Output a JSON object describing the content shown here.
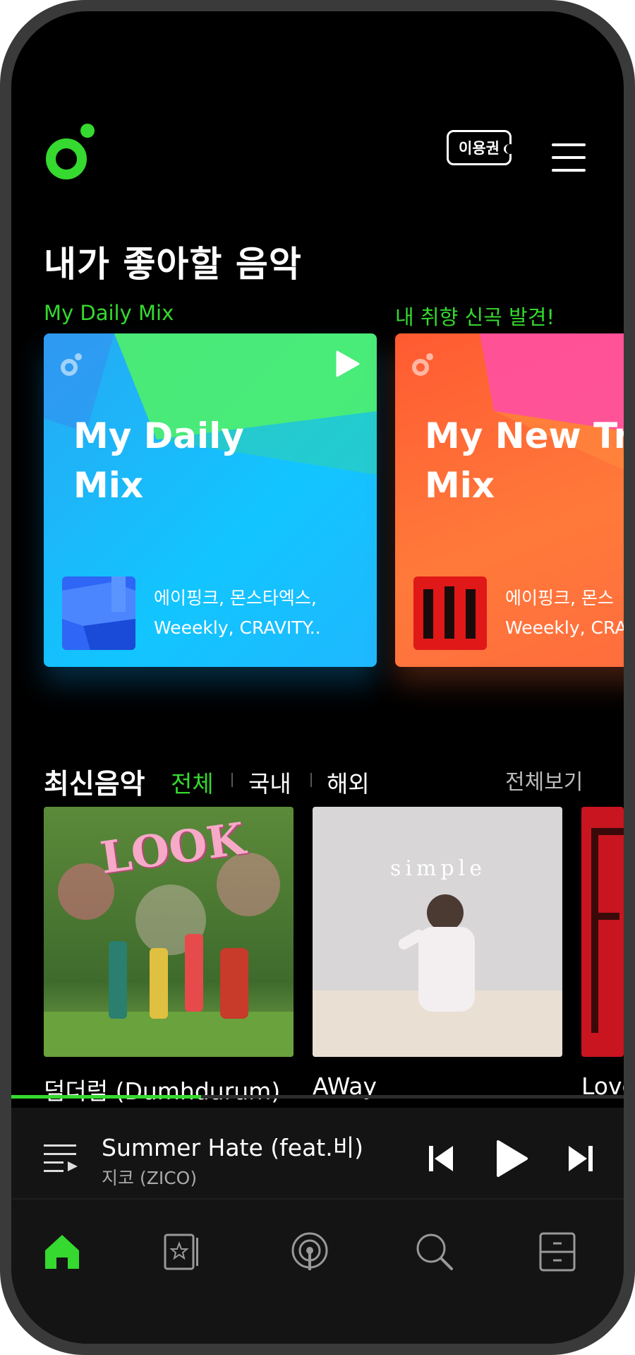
{
  "header": {
    "logo": "melon-logo",
    "ticket_label": "이용권",
    "menu_icon": "hamburger-menu-icon"
  },
  "recommend": {
    "title": "내가 좋아할 음악",
    "tabs": [
      "My Daily Mix",
      "내 취향 신곡 발견!"
    ],
    "cards": [
      {
        "title_line1": "My Daily",
        "title_line2": "Mix",
        "artists_line1": "에이핑크, 몬스타엑스,",
        "artists_line2": "Weeekly, CRAVITY.."
      },
      {
        "title_line1": "My New Tra",
        "title_line2": "Mix",
        "artists_line1": "에이핑크, 몬스",
        "artists_line2": "Weeekly, CRA"
      }
    ]
  },
  "new_music": {
    "title": "최신음악",
    "tabs": [
      "전체",
      "국내",
      "해외"
    ],
    "active_tab": "전체",
    "see_all": "전체보기",
    "albums": [
      {
        "name": "덤더럼 (Dumhdurum)",
        "cover_text": "LOOK"
      },
      {
        "name": "AWay",
        "cover_text": "simple"
      },
      {
        "name": "Love"
      }
    ]
  },
  "player": {
    "song": "Summer Hate (feat.비)",
    "artist": "지코 (ZICO)",
    "progress": 0.31
  },
  "nav": [
    "home-icon",
    "library-card-icon",
    "podcast-icon",
    "search-icon",
    "locker-icon"
  ],
  "colors": {
    "accent": "#35d92f",
    "background": "#000000"
  }
}
